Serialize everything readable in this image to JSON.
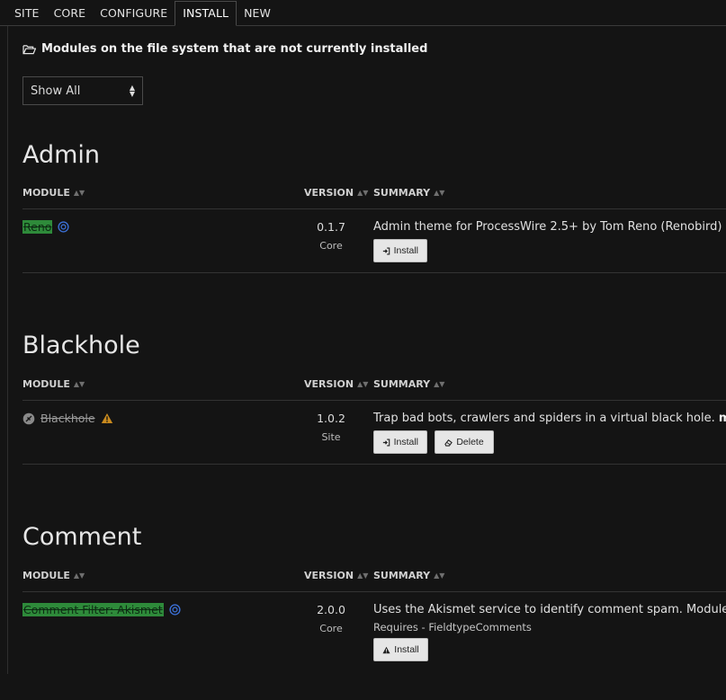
{
  "tabs": [
    "SITE",
    "CORE",
    "CONFIGURE",
    "INSTALL",
    "NEW"
  ],
  "active_tab": "INSTALL",
  "heading": "Modules on the file system that are not currently installed",
  "filter": {
    "selected": "Show All"
  },
  "columns": {
    "module": "MODULE",
    "version": "VERSION",
    "summary": "SUMMARY"
  },
  "sections": [
    {
      "title": "Admin",
      "modules": [
        {
          "name": "Reno",
          "version": "0.1.7",
          "source": "Core",
          "summary": "Admin theme for ProcessWire 2.5+ by Tom Reno (Renobird)",
          "buttons": [
            "Install"
          ]
        }
      ]
    },
    {
      "title": "Blackhole",
      "modules": [
        {
          "name": "Blackhole",
          "version": "1.0.2",
          "source": "Site",
          "summary": "Trap bad bots, crawlers and spiders in a virtual black hole.",
          "more": "more",
          "buttons": [
            "Install",
            "Delete"
          ]
        }
      ]
    },
    {
      "title": "Comment",
      "modules": [
        {
          "name": "Comment Filter: Akismet",
          "version": "2.0.0",
          "source": "Core",
          "summary": "Uses the Akismet service to identify comment spam. Module plug",
          "requires": "Requires - FieldtypeComments",
          "buttons": [
            "Install"
          ]
        }
      ]
    }
  ],
  "colors": {
    "background": "#141414",
    "highlight": "#2e8a3a",
    "button": "#e6e6e6",
    "warning": "#c98a1e",
    "core_icon": "#3b6fd4"
  }
}
